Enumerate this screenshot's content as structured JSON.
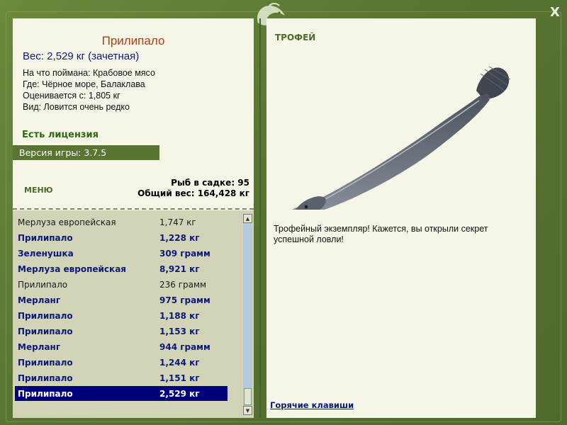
{
  "window": {
    "close_label": "X",
    "emblem_icon": "fish-emblem-icon"
  },
  "fish": {
    "title": "Прилипало",
    "weight_line": "Вес: 2,529 кг (зачетная)",
    "details": [
      "На что поймана: Крабовое мясо",
      "Где: Чёрное море, Балаклава",
      "Оценивается с: 1,805 кг",
      "Вид: Ловится очень редко"
    ]
  },
  "license_status": "Есть лицензия",
  "version_text": "Версия игры: 3.7.5",
  "menu_label": "МЕНЮ",
  "summary": {
    "fish_count": "Рыб в садке: 95",
    "total_weight": "Общий вес: 164,428 кг"
  },
  "catches": [
    {
      "name": "Мерлуза европейская",
      "weight": "1,747 кг",
      "style": "plain"
    },
    {
      "name": "Прилипало",
      "weight": "1,228 кг",
      "style": "bold"
    },
    {
      "name": "Зеленушка",
      "weight": "309 грамм",
      "style": "bold"
    },
    {
      "name": "Мерлуза европейская",
      "weight": "8,921 кг",
      "style": "bold"
    },
    {
      "name": "Прилипало",
      "weight": "236 грамм",
      "style": "plain"
    },
    {
      "name": "Мерланг",
      "weight": "975 грамм",
      "style": "bold"
    },
    {
      "name": "Прилипало",
      "weight": "1,188 кг",
      "style": "bold"
    },
    {
      "name": "Прилипало",
      "weight": "1,153 кг",
      "style": "bold"
    },
    {
      "name": "Мерланг",
      "weight": "944 грамм",
      "style": "bold"
    },
    {
      "name": "Прилипало",
      "weight": "1,244 кг",
      "style": "bold"
    },
    {
      "name": "Прилипало",
      "weight": "1,151 кг",
      "style": "bold"
    },
    {
      "name": "Прилипало",
      "weight": "2,529 кг",
      "style": "selected"
    }
  ],
  "scrollbar": {
    "up_icon": "scroll-up-arrow-icon",
    "down_icon": "scroll-down-arrow-icon",
    "position": 0.9
  },
  "trophy": {
    "header": "ТРОФЕЙ",
    "message": "Трофейный экземпляр! Кажется, вы открыли секрет успешной ловли!",
    "image_icon": "remora-fish-image"
  },
  "hotkeys_link": "Горячие клавиши",
  "colors": {
    "frame": "#5b7434",
    "panel": "#f6f6e8",
    "list_bg": "#d3d3b7",
    "title": "#b04010",
    "navy": "#0a1a78",
    "selected_row": "#00007a",
    "license": "#2e6a12"
  }
}
